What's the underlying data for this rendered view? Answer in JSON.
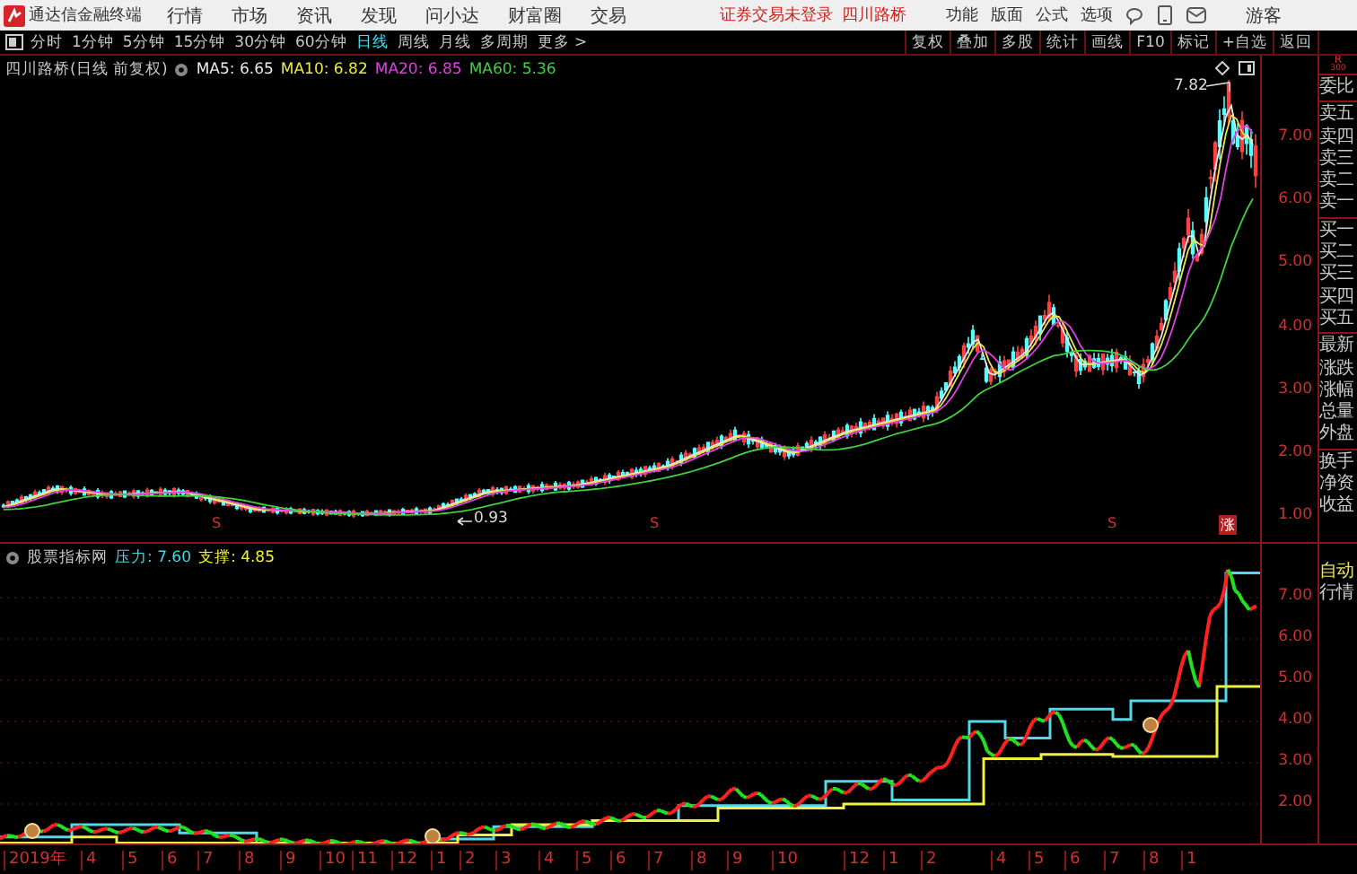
{
  "menu_bar": {
    "app_title": "通达信金融终端",
    "menus": [
      "行情",
      "市场",
      "资讯",
      "发现",
      "问小达",
      "财富圈",
      "交易"
    ],
    "login_status": "证券交易未登录",
    "stock_name": "四川路桥",
    "right_menus": [
      "功能",
      "版面",
      "公式",
      "选项"
    ],
    "user": "游客"
  },
  "period_tabs": [
    {
      "label": "分时",
      "selected": false
    },
    {
      "label": "1分钟",
      "selected": false
    },
    {
      "label": "5分钟",
      "selected": false
    },
    {
      "label": "15分钟",
      "selected": false
    },
    {
      "label": "30分钟",
      "selected": false
    },
    {
      "label": "60分钟",
      "selected": false
    },
    {
      "label": "日线",
      "selected": true
    },
    {
      "label": "周线",
      "selected": false
    },
    {
      "label": "月线",
      "selected": false
    },
    {
      "label": "多周期",
      "selected": false
    },
    {
      "label": "更多 >",
      "selected": false
    }
  ],
  "tool_buttons": [
    "复权",
    "叠加",
    "多股",
    "统计",
    "画线",
    "F10",
    "标记",
    "+自选",
    "返回"
  ],
  "main_chart": {
    "title": "四川路桥(日线 前复权)",
    "indicators": [
      {
        "label": "MA5: 6.65",
        "color": "#e8e8e8"
      },
      {
        "label": "MA10: 6.82",
        "color": "#e8e84a"
      },
      {
        "label": "MA20: 6.85",
        "color": "#e040e0"
      },
      {
        "label": "MA60: 5.36",
        "color": "#40d040"
      }
    ],
    "price_labels": [
      "7.00",
      "6.00",
      "5.00",
      "4.00",
      "3.00",
      "2.00",
      "1.00"
    ],
    "high_label": "7.82",
    "low_label": "0.93",
    "signal_markers": [
      "S",
      "S",
      "S"
    ],
    "limit_badge": "涨"
  },
  "sidebar": {
    "code": "R",
    "number": "300",
    "groups": [
      [
        "委比"
      ],
      [
        "卖五",
        "卖四",
        "卖三",
        "卖二",
        "卖一"
      ],
      [
        "买一",
        "买二",
        "买三",
        "买四",
        "买五"
      ],
      [
        "最新",
        "涨跌",
        "涨幅",
        "总量",
        "外盘"
      ],
      [
        "换手",
        "净资",
        "收益"
      ]
    ]
  },
  "lower_chart": {
    "indicator_name": "股票指标网",
    "pressure": "压力: 7.60",
    "support": "支撑: 4.85",
    "price_labels": [
      "7.00",
      "6.00",
      "5.00",
      "4.00",
      "3.00",
      "2.00"
    ]
  },
  "lower_sidebar": [
    "自动",
    "行情"
  ],
  "x_axis": [
    "2019年",
    "4",
    "5",
    "6",
    "7",
    "8",
    "9",
    "10",
    "11",
    "12",
    "1",
    "2",
    "3",
    "4",
    "5",
    "6",
    "7",
    "8",
    "9",
    "10",
    "12",
    "1",
    "2",
    "4",
    "5",
    "6",
    "7",
    "8",
    "1"
  ]
}
